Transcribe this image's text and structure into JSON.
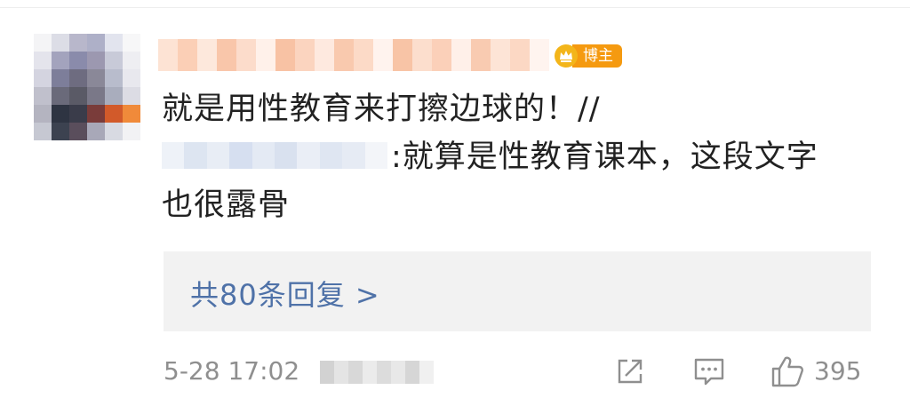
{
  "comment": {
    "author_badge": "博主",
    "line1": "就是用性教育来打擦边球的！//",
    "line2_suffix": ":就算是性教育课本，这段文字",
    "line3": "也很露骨"
  },
  "replies": {
    "label": "共80条回复 >"
  },
  "footer": {
    "timestamp": "5-28 17:02",
    "like_count": "395"
  },
  "icons": {
    "share": "share-icon",
    "comment": "comment-icon",
    "like": "thumbs-up-icon",
    "badge": "crown-icon"
  },
  "colors": {
    "link": "#4f72a8",
    "badge": "#f59a10",
    "meta_text": "#8f8f8f",
    "reply_bg": "#f2f2f2"
  }
}
